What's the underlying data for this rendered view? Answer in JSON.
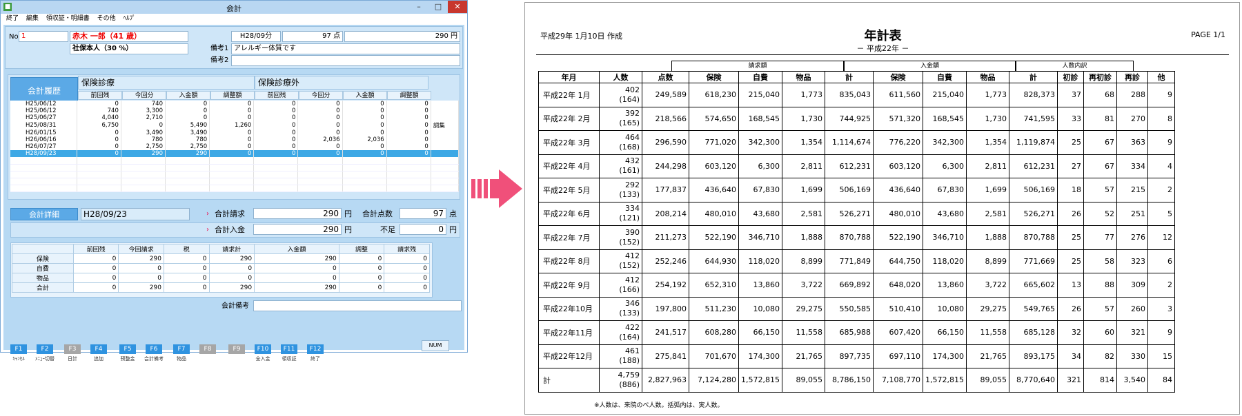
{
  "window": {
    "title": "会計",
    "controls": [
      "–",
      "□",
      "✕"
    ]
  },
  "menu": [
    "終了",
    "編集",
    "領収証・明細書",
    "その他",
    "ﾍﾙﾌﾟ"
  ],
  "patient": {
    "no_label": "No.",
    "no": "1",
    "name": "赤木 一郎（41 歳）",
    "insurance": "社保本人（30 %）",
    "period": "H28/09分",
    "points": "97 点",
    "amount": "290 円",
    "memo1_label": "備考1",
    "memo1": "アレルギー体質です",
    "memo2_label": "備考2",
    "memo2": ""
  },
  "history": {
    "button": "会計履歴",
    "ins_label": "保険診療",
    "nonins_label": "保険診療外",
    "columns": [
      "前回残",
      "今回分",
      "入金額",
      "調整額",
      "前回残",
      "今回分",
      "入金額",
      "調整額"
    ],
    "rows": [
      {
        "date": "H25/06/12",
        "v": [
          "0",
          "740",
          "0",
          "0",
          "0",
          "0",
          "0",
          "0"
        ],
        "note": ""
      },
      {
        "date": "H25/06/12",
        "v": [
          "740",
          "3,300",
          "0",
          "0",
          "0",
          "0",
          "0",
          "0"
        ],
        "note": ""
      },
      {
        "date": "H25/06/27",
        "v": [
          "4,040",
          "2,710",
          "0",
          "0",
          "0",
          "0",
          "0",
          "0"
        ],
        "note": ""
      },
      {
        "date": "H25/08/31",
        "v": [
          "6,750",
          "0",
          "5,490",
          "1,260",
          "0",
          "0",
          "0",
          "0"
        ],
        "note": "調集"
      },
      {
        "date": "H26/01/15",
        "v": [
          "0",
          "3,490",
          "3,490",
          "0",
          "0",
          "0",
          "0",
          "0"
        ],
        "note": ""
      },
      {
        "date": "H26/06/16",
        "v": [
          "0",
          "780",
          "780",
          "0",
          "0",
          "2,036",
          "2,036",
          "0"
        ],
        "note": ""
      },
      {
        "date": "H26/07/27",
        "v": [
          "0",
          "2,750",
          "2,750",
          "0",
          "0",
          "0",
          "0",
          "0"
        ],
        "note": ""
      },
      {
        "date": "H28/09/23",
        "v": [
          "0",
          "290",
          "290",
          "0",
          "0",
          "0",
          "0",
          "0"
        ],
        "note": ""
      }
    ]
  },
  "detail": {
    "button": "会計詳細",
    "date": "H28/09/23",
    "total_charge_label": "合計請求",
    "total_charge": "290",
    "yen": "円",
    "total_points_label": "合計点数",
    "total_points": "97",
    "points_unit": "点",
    "total_paid_label": "合計入金",
    "total_paid": "290",
    "shortage_label": "不足",
    "shortage": "0",
    "columns": [
      "前回残",
      "今回請求",
      "税",
      "請求計",
      "入金額",
      "調整",
      "請求残"
    ],
    "rows": [
      {
        "label": "保険",
        "v": [
          "0",
          "290",
          "0",
          "290",
          "290",
          "0",
          "0"
        ]
      },
      {
        "label": "自費",
        "v": [
          "0",
          "0",
          "0",
          "0",
          "0",
          "0",
          "0"
        ]
      },
      {
        "label": "物品",
        "v": [
          "0",
          "0",
          "0",
          "0",
          "0",
          "0",
          "0"
        ]
      },
      {
        "label": "合計",
        "v": [
          "0",
          "290",
          "0",
          "290",
          "290",
          "0",
          "0"
        ]
      }
    ],
    "memo_label": "会計備考",
    "memo": ""
  },
  "fkeys": [
    {
      "k": "F1",
      "t": "ｷｬﾝｾﾙ",
      "on": true
    },
    {
      "k": "F2",
      "t": "ﾒﾆｭｰ切替",
      "on": true
    },
    {
      "k": "F3",
      "t": "日計",
      "on": false
    },
    {
      "k": "F4",
      "t": "追加",
      "on": true
    },
    {
      "k": "F5",
      "t": "预整金",
      "on": true
    },
    {
      "k": "F6",
      "t": "会計備考",
      "on": true
    },
    {
      "k": "F7",
      "t": "物品",
      "on": true
    },
    {
      "k": "F8",
      "t": "",
      "on": false
    },
    {
      "k": "F9",
      "t": "",
      "on": false
    },
    {
      "k": "F10",
      "t": "全入金",
      "on": true
    },
    {
      "k": "F11",
      "t": "領収証",
      "on": true
    },
    {
      "k": "F12",
      "t": "終了",
      "on": true
    }
  ],
  "status": {
    "num": "NUM"
  },
  "colors": {
    "accent": "#2f93e0",
    "arrow": "#f0507a",
    "selected_row": "#3da8e5",
    "window_bg": "#b7d9f3"
  },
  "report": {
    "created": "平成29年 1月10日 作成",
    "title": "年計表",
    "subtitle": "－ 平成22年 －",
    "page": "PAGE 1/1",
    "groups": [
      "請求額",
      "入金額",
      "人数内訳"
    ],
    "headers": [
      "年月",
      "人数",
      "点数",
      "保険",
      "自費",
      "物品",
      "計",
      "保険",
      "自費",
      "物品",
      "計",
      "初診",
      "再初診",
      "再診",
      "他"
    ],
    "rows": [
      {
        "ym": "平成22年 1月",
        "p": "402",
        "pp": "(164)",
        "v": [
          "249,589",
          "618,230",
          "215,040",
          "1,773",
          "835,043",
          "611,560",
          "215,040",
          "1,773",
          "828,373",
          "37",
          "68",
          "288",
          "9"
        ]
      },
      {
        "ym": "平成22年 2月",
        "p": "392",
        "pp": "(165)",
        "v": [
          "218,566",
          "574,650",
          "168,545",
          "1,730",
          "744,925",
          "571,320",
          "168,545",
          "1,730",
          "741,595",
          "33",
          "81",
          "270",
          "8"
        ]
      },
      {
        "ym": "平成22年 3月",
        "p": "464",
        "pp": "(168)",
        "v": [
          "296,590",
          "771,020",
          "342,300",
          "1,354",
          "1,114,674",
          "776,220",
          "342,300",
          "1,354",
          "1,119,874",
          "25",
          "67",
          "363",
          "9"
        ]
      },
      {
        "ym": "平成22年 4月",
        "p": "432",
        "pp": "(161)",
        "v": [
          "244,298",
          "603,120",
          "6,300",
          "2,811",
          "612,231",
          "603,120",
          "6,300",
          "2,811",
          "612,231",
          "27",
          "67",
          "334",
          "4"
        ]
      },
      {
        "ym": "平成22年 5月",
        "p": "292",
        "pp": "(133)",
        "v": [
          "177,837",
          "436,640",
          "67,830",
          "1,699",
          "506,169",
          "436,640",
          "67,830",
          "1,699",
          "506,169",
          "18",
          "57",
          "215",
          "2"
        ]
      },
      {
        "ym": "平成22年 6月",
        "p": "334",
        "pp": "(121)",
        "v": [
          "208,214",
          "480,010",
          "43,680",
          "2,581",
          "526,271",
          "480,010",
          "43,680",
          "2,581",
          "526,271",
          "26",
          "52",
          "251",
          "5"
        ]
      },
      {
        "ym": "平成22年 7月",
        "p": "390",
        "pp": "(152)",
        "v": [
          "211,273",
          "522,190",
          "346,710",
          "1,888",
          "870,788",
          "522,190",
          "346,710",
          "1,888",
          "870,788",
          "25",
          "77",
          "276",
          "12"
        ]
      },
      {
        "ym": "平成22年 8月",
        "p": "412",
        "pp": "(152)",
        "v": [
          "252,246",
          "644,930",
          "118,020",
          "8,899",
          "771,849",
          "644,750",
          "118,020",
          "8,899",
          "771,669",
          "25",
          "58",
          "323",
          "6"
        ]
      },
      {
        "ym": "平成22年 9月",
        "p": "412",
        "pp": "(166)",
        "v": [
          "254,192",
          "652,310",
          "13,860",
          "3,722",
          "669,892",
          "648,020",
          "13,860",
          "3,722",
          "665,602",
          "13",
          "88",
          "309",
          "2"
        ]
      },
      {
        "ym": "平成22年10月",
        "p": "346",
        "pp": "(133)",
        "v": [
          "197,800",
          "511,230",
          "10,080",
          "29,275",
          "550,585",
          "510,410",
          "10,080",
          "29,275",
          "549,765",
          "26",
          "57",
          "260",
          "3"
        ]
      },
      {
        "ym": "平成22年11月",
        "p": "422",
        "pp": "(164)",
        "v": [
          "241,517",
          "608,280",
          "66,150",
          "11,558",
          "685,988",
          "607,420",
          "66,150",
          "11,558",
          "685,128",
          "32",
          "60",
          "321",
          "9"
        ]
      },
      {
        "ym": "平成22年12月",
        "p": "461",
        "pp": "(188)",
        "v": [
          "275,841",
          "701,670",
          "174,300",
          "21,765",
          "897,735",
          "697,110",
          "174,300",
          "21,765",
          "893,175",
          "34",
          "82",
          "330",
          "15"
        ]
      },
      {
        "ym": "計",
        "p": "4,759",
        "pp": "(886)",
        "v": [
          "2,827,963",
          "7,124,280",
          "1,572,815",
          "89,055",
          "8,786,150",
          "7,108,770",
          "1,572,815",
          "89,055",
          "8,770,640",
          "321",
          "814",
          "3,540",
          "84"
        ]
      }
    ],
    "footnote": "※人数は、来院のべ人数。括弧内は、実人数。"
  }
}
